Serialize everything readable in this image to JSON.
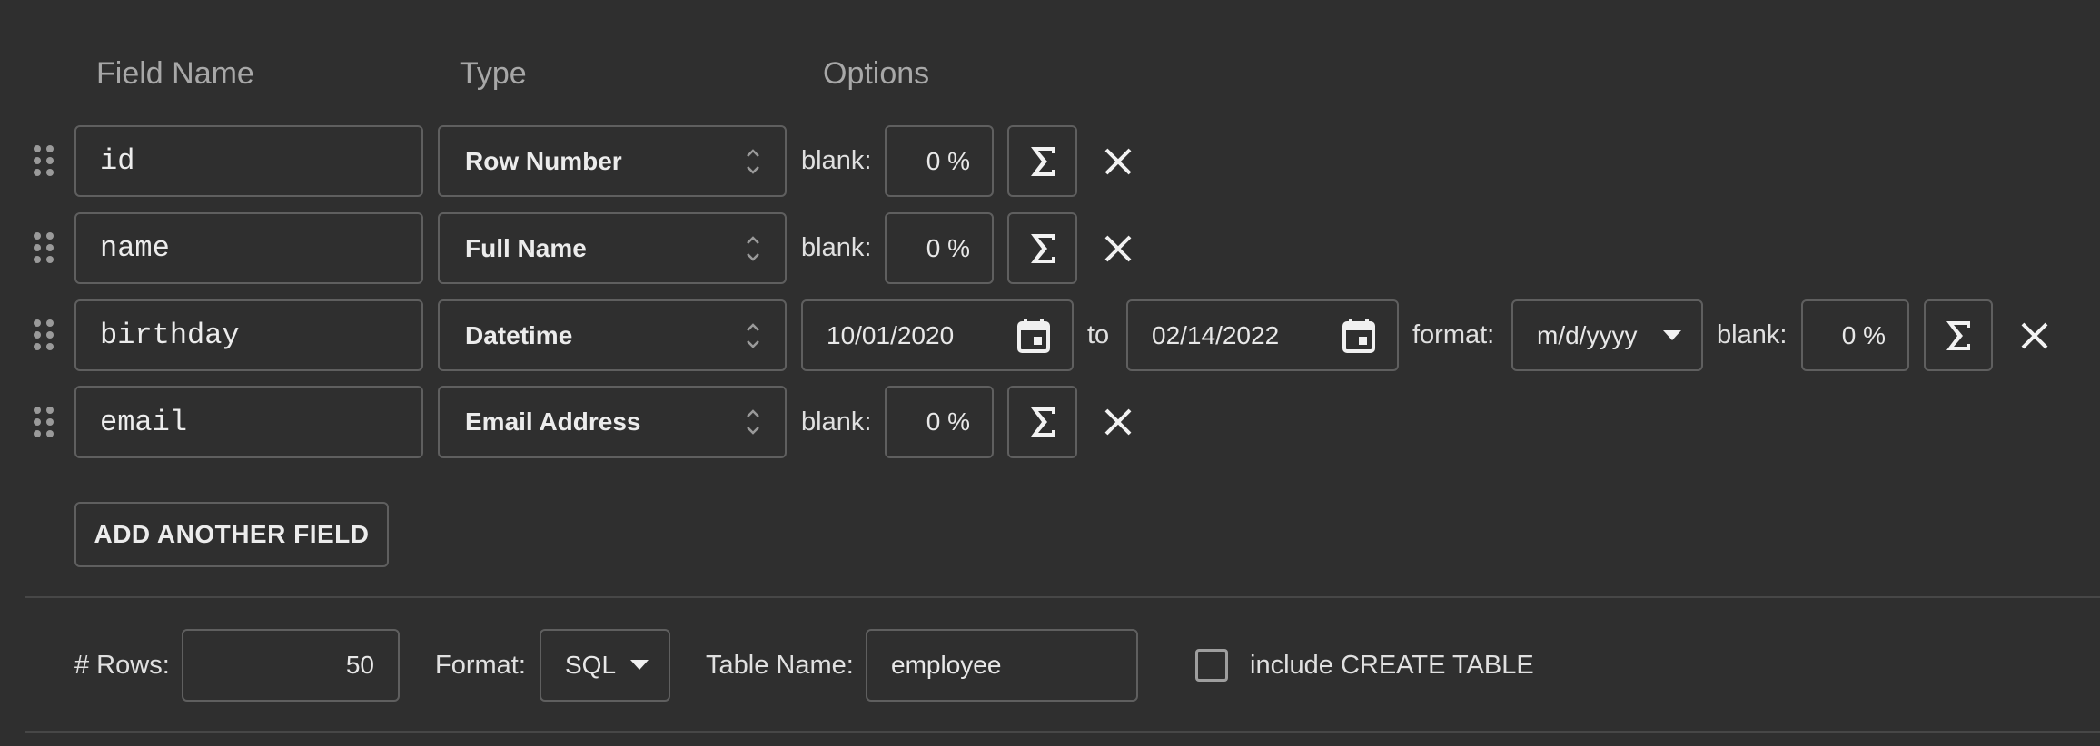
{
  "headers": {
    "field_name": "Field Name",
    "type": "Type",
    "options": "Options"
  },
  "rows": [
    {
      "field": "id",
      "type": "Row Number",
      "blank_label": "blank:",
      "blank_value": "0 %"
    },
    {
      "field": "name",
      "type": "Full Name",
      "blank_label": "blank:",
      "blank_value": "0 %"
    },
    {
      "field": "birthday",
      "type": "Datetime",
      "date_from": "10/01/2020",
      "to_label": "to",
      "date_to": "02/14/2022",
      "format_label": "format:",
      "format_value": "m/d/yyyy",
      "blank_label": "blank:",
      "blank_value": "0 %"
    },
    {
      "field": "email",
      "type": "Email Address",
      "blank_label": "blank:",
      "blank_value": "0 %"
    }
  ],
  "add_field_label": "ADD ANOTHER FIELD",
  "footer": {
    "rows_label": "# Rows:",
    "rows_value": "50",
    "format_label": "Format:",
    "format_value": "SQL",
    "table_name_label": "Table Name:",
    "table_name_value": "employee",
    "create_table_label": "include CREATE TABLE",
    "create_table_checked": false
  },
  "icons": {
    "drag": "drag-handle-icon",
    "sigma": "sigma-icon",
    "close": "close-icon",
    "calendar": "calendar-icon",
    "chevrons": "chevron-updown-icon",
    "caret": "caret-down-icon"
  },
  "colors": {
    "background": "#2f2f2f",
    "border": "#5f5f5f",
    "text": "#e8e8e8",
    "header_text": "#a8a8a8"
  }
}
